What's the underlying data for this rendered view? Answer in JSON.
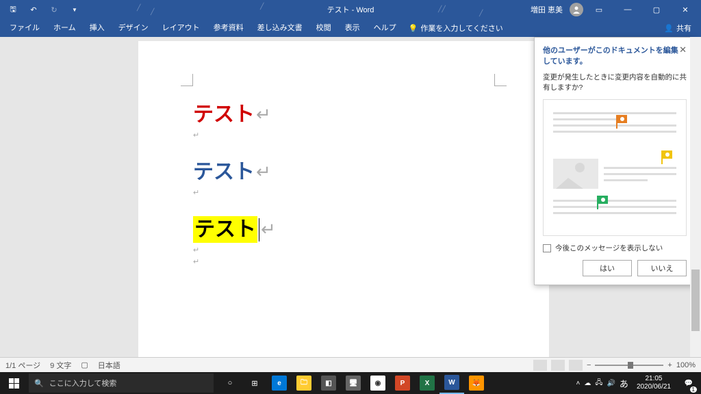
{
  "titlebar": {
    "title": "テスト  -  Word",
    "user_name": "増田 恵美"
  },
  "ribbon": {
    "tabs": [
      "ファイル",
      "ホーム",
      "挿入",
      "デザイン",
      "レイアウト",
      "参考資料",
      "差し込み文書",
      "校閲",
      "表示",
      "ヘルプ"
    ],
    "tellme_placeholder": "作業を入力してください",
    "share_label": "共有"
  },
  "document": {
    "line1": "テスト",
    "line2": "テスト",
    "line3": "テスト"
  },
  "popup": {
    "title": "他のユーザーがこのドキュメントを編集しています。",
    "body": "変更が発生したときに変更内容を自動的に共有しますか?",
    "checkbox_label": "今後このメッセージを表示しない",
    "btn_yes": "はい",
    "btn_no": "いいえ"
  },
  "statusbar": {
    "page": "1/1 ページ",
    "words": "9 文字",
    "lang": "日本語",
    "zoom": "100%"
  },
  "taskbar": {
    "search_placeholder": "ここに入力して検索",
    "ime": "あ",
    "time": "21:05",
    "date": "2020/06/21",
    "notif_count": "1"
  }
}
